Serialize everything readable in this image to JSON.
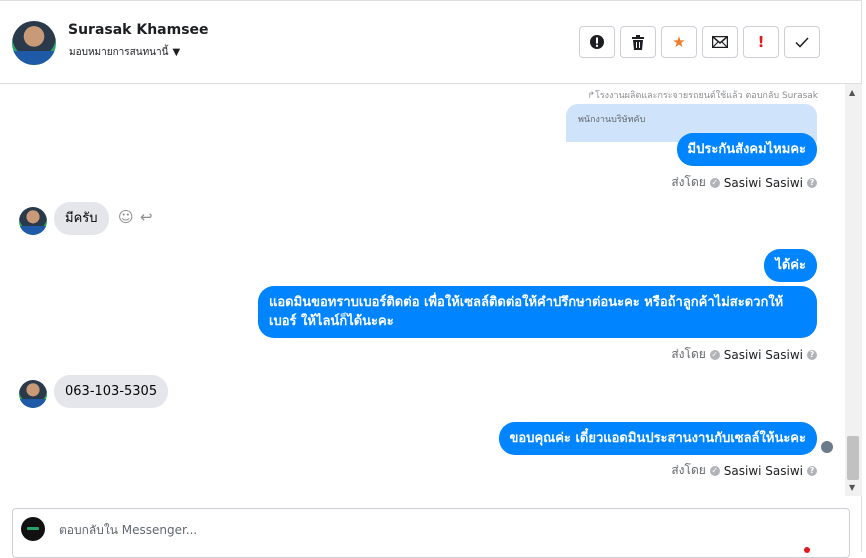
{
  "header": {
    "user_name": "Surasak Khamsee",
    "assign_label": "มอบหมายการสนทนานี้",
    "actions": [
      {
        "name": "report-button",
        "icon": "alert-circle-icon",
        "glyph": "⬤"
      },
      {
        "name": "delete-button",
        "icon": "trash-icon",
        "glyph": "🗑"
      },
      {
        "name": "star-button",
        "icon": "star-icon",
        "glyph": "★"
      },
      {
        "name": "mark-unread-button",
        "icon": "envelope-icon",
        "glyph": "✉"
      },
      {
        "name": "important-button",
        "icon": "exclamation-icon",
        "glyph": "!"
      },
      {
        "name": "done-button",
        "icon": "check-icon",
        "glyph": "✓"
      }
    ]
  },
  "chat": {
    "reply_note": "↱โรงงานผลิตและกระจายรถยนต์ใช้แล้ว ตอบกลับ Surasak",
    "quoted_text": "พนักงานบริษัทคับ",
    "messages": {
      "m1": "มีประกันสังคมไหมคะ",
      "m2": "มีครับ",
      "m3": "ได้ค่ะ",
      "m4": "แอดมินขอทราบเบอร์ติดต่อ เพื่อให้เซลล์ติดต่อให้คำปรึกษาต่อนะคะ หรือถ้าลูกค้าไม่สะดวกให้เบอร์ ให้ไลน์ก็ได้นะคะ",
      "m5": "063-103-5305",
      "m6": "ขอบคุณค่ะ เดี๋ยวแอดมินประสานงานกับเซลล์ให้นะคะ"
    },
    "sent_by_prefix": "ส่งโดย",
    "agent_name": "Sasiwi Sasiwi"
  },
  "composer": {
    "placeholder": "ตอบกลับใน Messenger..."
  },
  "colors": {
    "outgoing": "#0084ff",
    "incoming": "#e4e6eb",
    "quoted": "#cfe3fb"
  }
}
